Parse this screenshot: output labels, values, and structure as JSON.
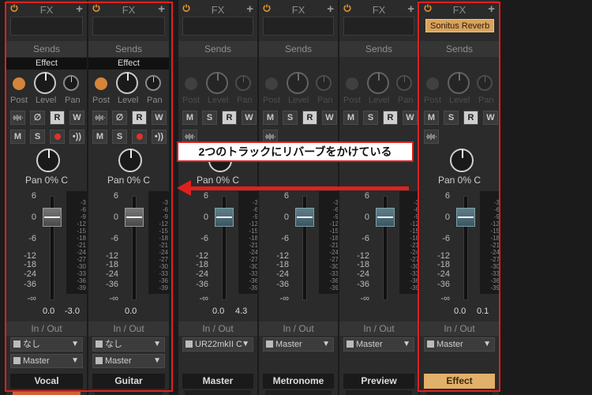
{
  "fx_label": "FX",
  "sends_label": "Sends",
  "io_label": "In / Out",
  "knob_labels": {
    "post": "Post",
    "level": "Level",
    "pan": "Pan"
  },
  "pan_label": "Pan 0% C",
  "buttons": {
    "mono": "M",
    "solo": "S",
    "read": "R",
    "write": "W"
  },
  "scale_labels": [
    "6",
    "0",
    "-6",
    "-12",
    "-18",
    "-24",
    "-36",
    "-∞"
  ],
  "meter_labels": [
    "-3",
    "-6",
    "-9",
    "-12",
    "-15",
    "-18",
    "-21",
    "-24",
    "-27",
    "-30",
    "-33",
    "-36",
    "-39"
  ],
  "strips": [
    {
      "name": "Vocal",
      "send_name": "Effect",
      "gain": "0.0",
      "peak": "-3.0",
      "input": "なし",
      "output": "Master",
      "plugin": ""
    },
    {
      "name": "Guitar",
      "send_name": "Effect",
      "gain": "0.0",
      "peak": "",
      "input": "なし",
      "output": "Master",
      "plugin": ""
    },
    {
      "name": "Master",
      "send_name": "",
      "gain": "0.0",
      "peak": "4.3",
      "input": "",
      "output": "UR22mkII C",
      "plugin": ""
    },
    {
      "name": "Metronome",
      "send_name": "",
      "gain": "",
      "peak": "",
      "input": "",
      "output": "Master",
      "plugin": ""
    },
    {
      "name": "Preview",
      "send_name": "",
      "gain": "",
      "peak": "",
      "input": "",
      "output": "Master",
      "plugin": ""
    },
    {
      "name": "Effect",
      "send_name": "",
      "gain": "0.0",
      "peak": "0.1",
      "input": "",
      "output": "Master",
      "plugin": "Sonitus Reverb"
    }
  ],
  "annotation": {
    "text": "2つのトラックにリバーブをかけている"
  },
  "colors": {
    "highlight": "#e02020",
    "accent": "#d9a35c",
    "record": "#e03030"
  }
}
